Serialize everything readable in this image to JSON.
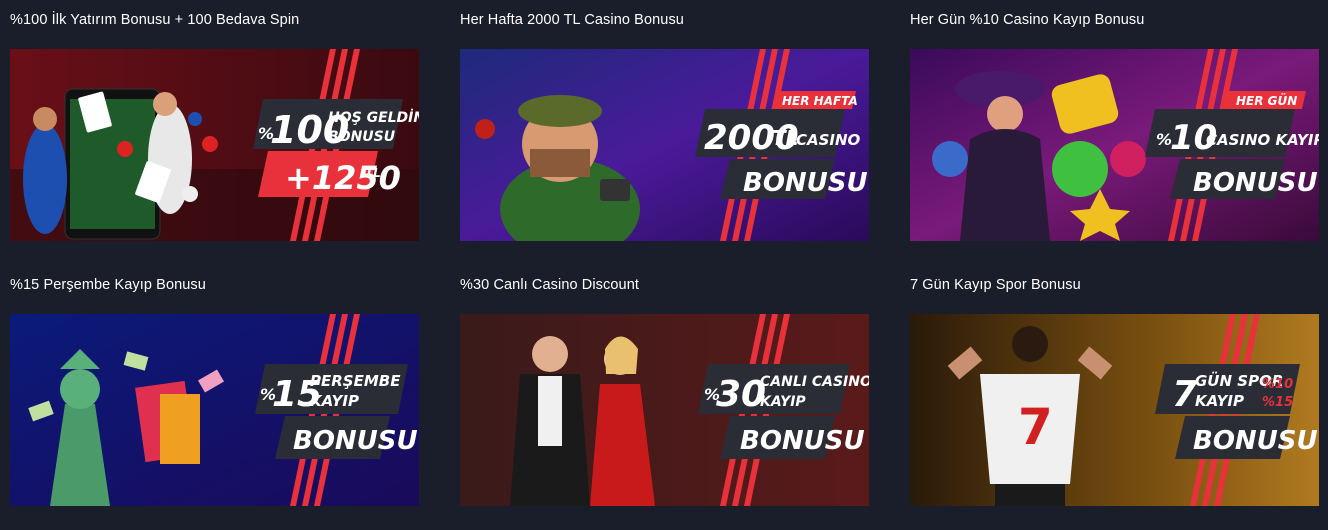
{
  "cards": [
    {
      "title": "%100 İlk Yatırım Bonusu + 100 Bedava Spin",
      "banner": {
        "bg_from": "#3a0a10",
        "bg_to": "#7a1420",
        "tag": "",
        "line1_prefix": "%",
        "line1_num": "100",
        "line1_text_a": "HOŞ GELDİN",
        "line1_text_b": "BONUSU",
        "line2": "+1250",
        "line2_suffix": "TL"
      }
    },
    {
      "title": "Her Hafta 2000 TL Casino Bonusu",
      "banner": {
        "bg_from": "#2a1a6a",
        "bg_to": "#6a1a8a",
        "tag": "HER HAFTA",
        "line1_num": "2000",
        "line1_mid": "TL",
        "line1_text": "CASINO",
        "line2": "BONUSU"
      }
    },
    {
      "title": "Her Gün %10 Casino Kayıp Bonusu",
      "banner": {
        "bg_from": "#3a0a4a",
        "bg_to": "#8a1a7a",
        "tag": "HER GÜN",
        "line1_prefix": "%",
        "line1_num": "10",
        "line1_text": "CASINO KAYIP",
        "line2": "BONUSU"
      }
    },
    {
      "title": "%15 Perşembe Kayıp Bonusu",
      "banner": {
        "bg_from": "#0a1a6a",
        "bg_to": "#2a1a8a",
        "tag": "",
        "line1_prefix": "%",
        "line1_num": "15",
        "line1_text_a": "PERŞEMBE",
        "line1_text_b": "KAYIP",
        "line2": "BONUSU"
      }
    },
    {
      "title": "%30 Canlı Casino Discount",
      "banner": {
        "bg_from": "#2a0a0a",
        "bg_to": "#6a1a1a",
        "tag": "",
        "line1_prefix": "%",
        "line1_num": "30",
        "line1_text_a": "CANLI CASINO",
        "line1_text_b": "KAYIP",
        "line2": "BONUSU"
      }
    },
    {
      "title": "7 Gün Kayıp Spor Bonusu",
      "banner": {
        "bg_from": "#3a2a0a",
        "bg_to": "#9a6a1a",
        "tag": "",
        "line1_num": "7",
        "line1_text_a": "GÜN SPOR",
        "line1_text_b": "KAYIP",
        "side_a": "%10",
        "side_b": "%15",
        "line2": "BONUSU"
      }
    }
  ],
  "colors": {
    "accent_red": "#e8313b",
    "panel_dark": "#2a2d36",
    "page_bg": "#1a1e2b"
  }
}
